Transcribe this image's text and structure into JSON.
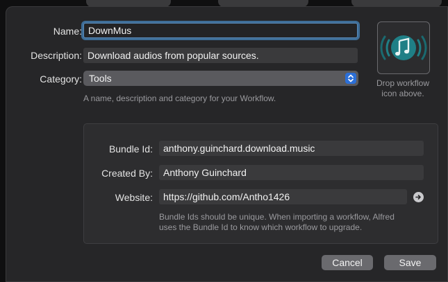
{
  "form": {
    "name_label": "Name:",
    "name_value": "DownMus",
    "description_label": "Description:",
    "description_value": "Download audios from popular sources.",
    "category_label": "Category:",
    "category_value": "Tools",
    "hint": "A name, description and category for your Workflow."
  },
  "icon_drop": {
    "line1": "Drop workflow",
    "line2": "icon above."
  },
  "bundle": {
    "bundle_id_label": "Bundle Id:",
    "bundle_id_value": "anthony.guinchard.download.music",
    "created_by_label": "Created By:",
    "created_by_value": "Anthony Guinchard",
    "website_label": "Website:",
    "website_value": "https://github.com/Antho1426",
    "hint_line1": "Bundle Ids should be unique. When importing a workflow, Alfred",
    "hint_line2": "uses the Bundle Id to know which workflow to upgrade."
  },
  "buttons": {
    "cancel": "Cancel",
    "save": "Save"
  },
  "colors": {
    "accent": "#2b6fd8",
    "focus_ring": "#3e6d97",
    "icon_teal": "#1f7f86"
  }
}
